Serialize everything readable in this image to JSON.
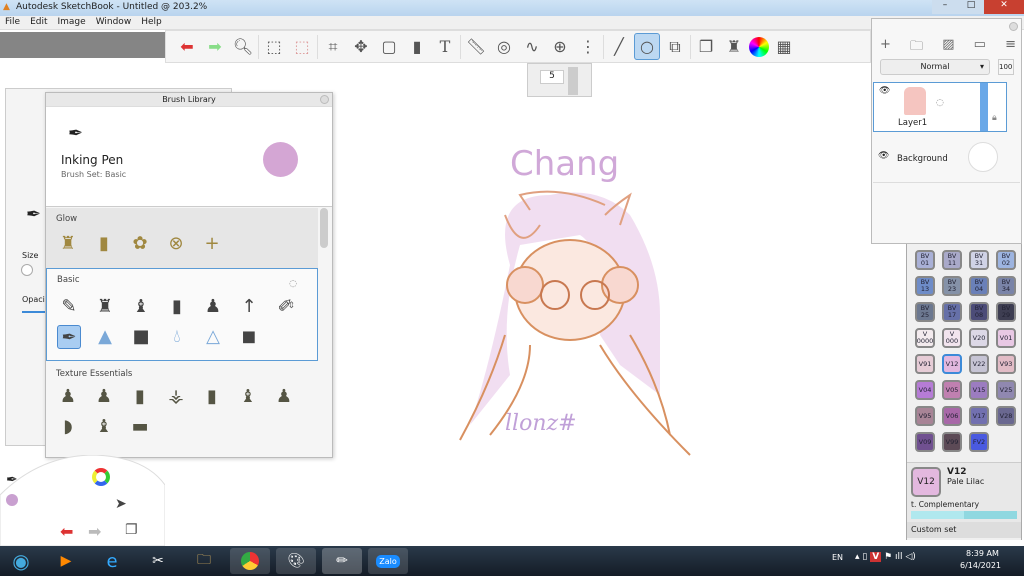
{
  "window": {
    "title": "Autodesk SketchBook - Untitled @ 203.2%"
  },
  "menu": [
    "File",
    "Edit",
    "Image",
    "Window",
    "Help"
  ],
  "toolbar": {
    "tools": [
      "undo-icon",
      "redo-icon",
      "zoom-icon",
      "select-icon",
      "transform-select-icon",
      "crop-icon",
      "move-icon",
      "distort-icon",
      "fill-icon",
      "text-icon",
      "ruler-icon",
      "ellipse-guide-icon",
      "curve-icon",
      "perspective-icon",
      "symmetry-icon",
      "stroke-icon",
      "shape-icon",
      "shapes-icon",
      "copy-icon",
      "brush-library-icon",
      "color-wheel-icon",
      "palette-icon"
    ]
  },
  "brush_size": "5",
  "left_panel": {
    "size_label": "Size",
    "opacity_label": "Opacit"
  },
  "brush_library": {
    "title": "Brush Library",
    "brush_name": "Inking Pen",
    "brush_set": "Brush Set: Basic",
    "color": "#d4a6d4",
    "sections": [
      {
        "name": "Glow"
      },
      {
        "name": "Basic"
      },
      {
        "name": "Texture Essentials"
      }
    ]
  },
  "layers": {
    "blend_mode": "Normal",
    "opacity": "100",
    "items": [
      {
        "name": "Layer1"
      },
      {
        "name": "Background"
      }
    ]
  },
  "swatches": [
    {
      "code": "BV\n01",
      "color": "#a9b0d6"
    },
    {
      "code": "BV\n11",
      "color": "#a9a9c9"
    },
    {
      "code": "BV\n31",
      "color": "#d0d3e6"
    },
    {
      "code": "BV\n02",
      "color": "#9db4e0"
    },
    {
      "code": "BV\n13",
      "color": "#6e8cc8"
    },
    {
      "code": "BV\n23",
      "color": "#8592a8"
    },
    {
      "code": "BV\n04",
      "color": "#6a80b8"
    },
    {
      "code": "BV\n34",
      "color": "#7a84a8"
    },
    {
      "code": "BV\n25",
      "color": "#6c7890"
    },
    {
      "code": "BV\n17",
      "color": "#6670a8"
    },
    {
      "code": "BV\n08",
      "color": "#4c4c78"
    },
    {
      "code": "BV\n29",
      "color": "#3e3e52"
    },
    {
      "code": "V\n0000",
      "color": "#f3ebee"
    },
    {
      "code": "V\n000",
      "color": "#f2e4ee"
    },
    {
      "code": "V20",
      "color": "#dcd8e6"
    },
    {
      "code": "V01",
      "color": "#e8c8e4"
    },
    {
      "code": "V91",
      "color": "#e6ccd6"
    },
    {
      "code": "V12",
      "color": "#e3b8df"
    },
    {
      "code": "V22",
      "color": "#c6c4d4"
    },
    {
      "code": "V93",
      "color": "#e2bcc6"
    },
    {
      "code": "V04",
      "color": "#b67cd6"
    },
    {
      "code": "V05",
      "color": "#c080b0"
    },
    {
      "code": "V15",
      "color": "#9c7cc0"
    },
    {
      "code": "V25",
      "color": "#9088b0"
    },
    {
      "code": "V95",
      "color": "#a88496"
    },
    {
      "code": "V06",
      "color": "#a868a8"
    },
    {
      "code": "V17",
      "color": "#7270b0"
    },
    {
      "code": "V28",
      "color": "#6a6890"
    },
    {
      "code": "V09",
      "color": "#705090"
    },
    {
      "code": "V99",
      "color": "#5c4a56"
    },
    {
      "code": "FV2",
      "color": "#4a5ae0"
    }
  ],
  "selected_color": {
    "code": "V12",
    "name": "Pale Lilac",
    "color": "#e3b8df",
    "complementary_label": "t. Complementary",
    "set_label": "Custom set"
  },
  "drawing": {
    "title_text": "Chang",
    "signature": "llonz#"
  },
  "tray": {
    "lang": "EN",
    "time": "8:39 AM",
    "date": "6/14/2021"
  },
  "taskbar": {
    "zalo": "Zalo"
  }
}
